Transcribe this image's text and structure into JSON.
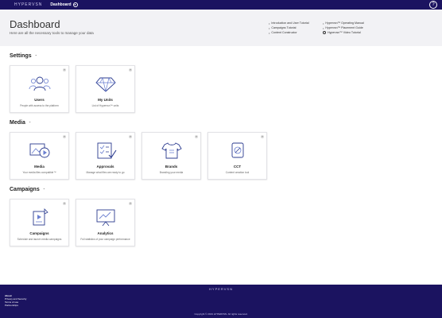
{
  "topbar": {
    "brand": "HYPERVSN",
    "nav_item": "Dashboard",
    "nav_icon": "chevron-down-icon",
    "help_label": "?"
  },
  "hero": {
    "title": "Dashboard",
    "subtitle": "Here are all the necessary tools to manage your data",
    "links_left": [
      "Introduction and User Tutorial",
      "Campaigns Tutorial",
      "Content Constructor"
    ],
    "links_right": [
      "Hypervsn™ Operating Manual",
      "Hypervsn™ Placement Guide",
      "Hypervsn™ Video Tutorial"
    ]
  },
  "sections": {
    "settings": {
      "title": "Settings",
      "cards": [
        {
          "title": "Users",
          "desc": "People with access to the platform",
          "icon": "users-icon"
        },
        {
          "title": "My Units",
          "desc": "List of Hypervsn™ units",
          "icon": "diamond-icon"
        }
      ]
    },
    "media": {
      "title": "Media",
      "cards": [
        {
          "title": "Media",
          "desc": "Your media files compatible™",
          "icon": "media-icon"
        },
        {
          "title": "Approvals",
          "desc": "Manage what files are ready to go",
          "icon": "approvals-icon"
        },
        {
          "title": "Brands",
          "desc": "Branding your media",
          "icon": "shirt-icon"
        },
        {
          "title": "CCT",
          "desc": "Content creation tool",
          "icon": "cct-icon"
        }
      ]
    },
    "campaigns": {
      "title": "Campaigns",
      "cards": [
        {
          "title": "Campaigns",
          "desc": "Schedule and launch media campaigns",
          "icon": "campaigns-icon"
        },
        {
          "title": "Analytics",
          "desc": "Full statistics of your campaign performance",
          "icon": "analytics-icon"
        }
      ]
    }
  },
  "footer": {
    "brand": "HYPERVSN",
    "links": [
      "About",
      "Privacy and Security",
      "Terms of use",
      "Partnerships"
    ],
    "copyright": "Copyright © 2019 HYPERVSN. All rights reserved."
  },
  "colors": {
    "brand": "#1b1360",
    "icon_stroke": "#2b3b8f",
    "icon_accent": "#6a7fd0"
  }
}
